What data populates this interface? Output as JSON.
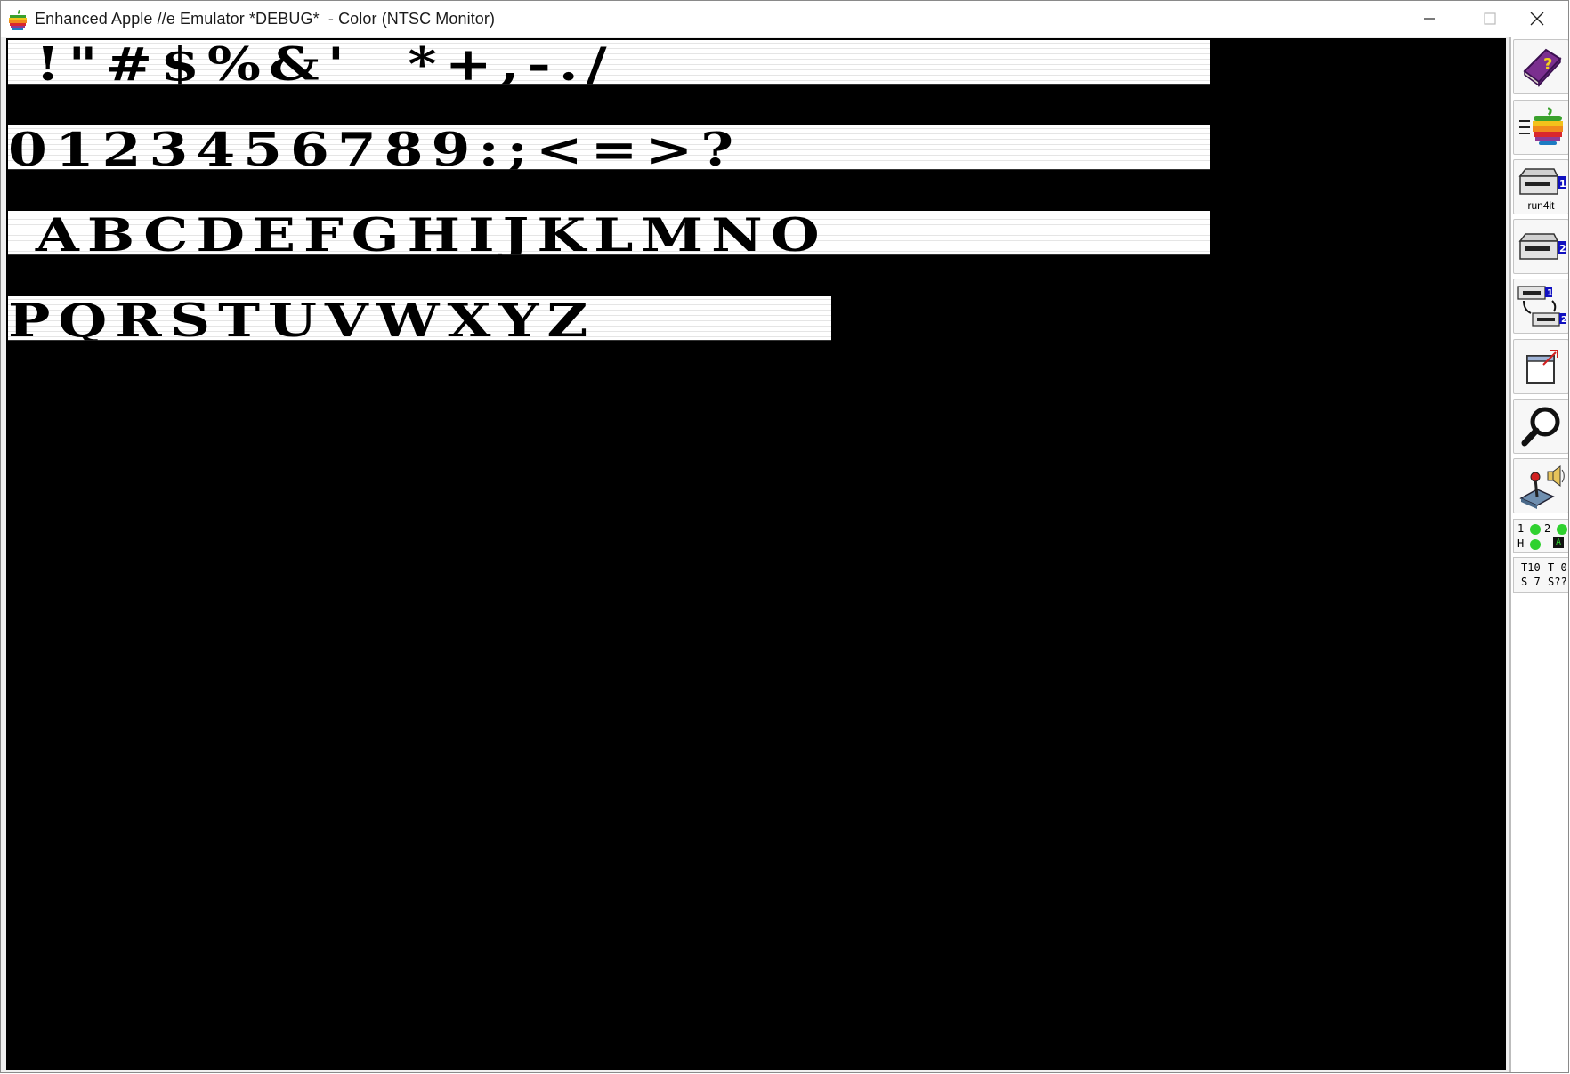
{
  "window": {
    "title": "Enhanced Apple //e Emulator *DEBUG*  - Color (NTSC Monitor)",
    "controls": {
      "minimize": "minimize",
      "maximize": "maximize",
      "close": "close"
    }
  },
  "screen": {
    "rows": [
      " !\"#$%&'  *+,-./",
      "0123456789:;<=>?",
      " ABCDEFGHIJKLMNO",
      "PQRSTUVWXYZ"
    ]
  },
  "toolbar": {
    "buttons": [
      {
        "name": "help-button",
        "icon": "help-book-icon"
      },
      {
        "name": "run-button",
        "icon": "apple-run-icon"
      },
      {
        "name": "drive1-button",
        "icon": "disk-drive-1-icon",
        "label": "run4it"
      },
      {
        "name": "drive2-button",
        "icon": "disk-drive-2-icon"
      },
      {
        "name": "swap-drives-button",
        "icon": "swap-drives-icon"
      },
      {
        "name": "fullscreen-button",
        "icon": "fullscreen-icon"
      },
      {
        "name": "debugger-button",
        "icon": "magnifier-icon"
      },
      {
        "name": "settings-button",
        "icon": "joystick-speaker-icon"
      }
    ],
    "leds": {
      "d1": "1",
      "d2": "2",
      "hdd": "H",
      "caps": "A"
    },
    "track_sector": {
      "t1": "T10",
      "t2": "T 0",
      "s1": "S 7",
      "s2": "S??"
    }
  },
  "colors": {
    "screen_bg": "#000000",
    "screen_text_bg": "#ffffff",
    "led_green": "#2fd12f",
    "led_dark_green": "#1f7a1f",
    "drive_blue": "#1010c0"
  }
}
